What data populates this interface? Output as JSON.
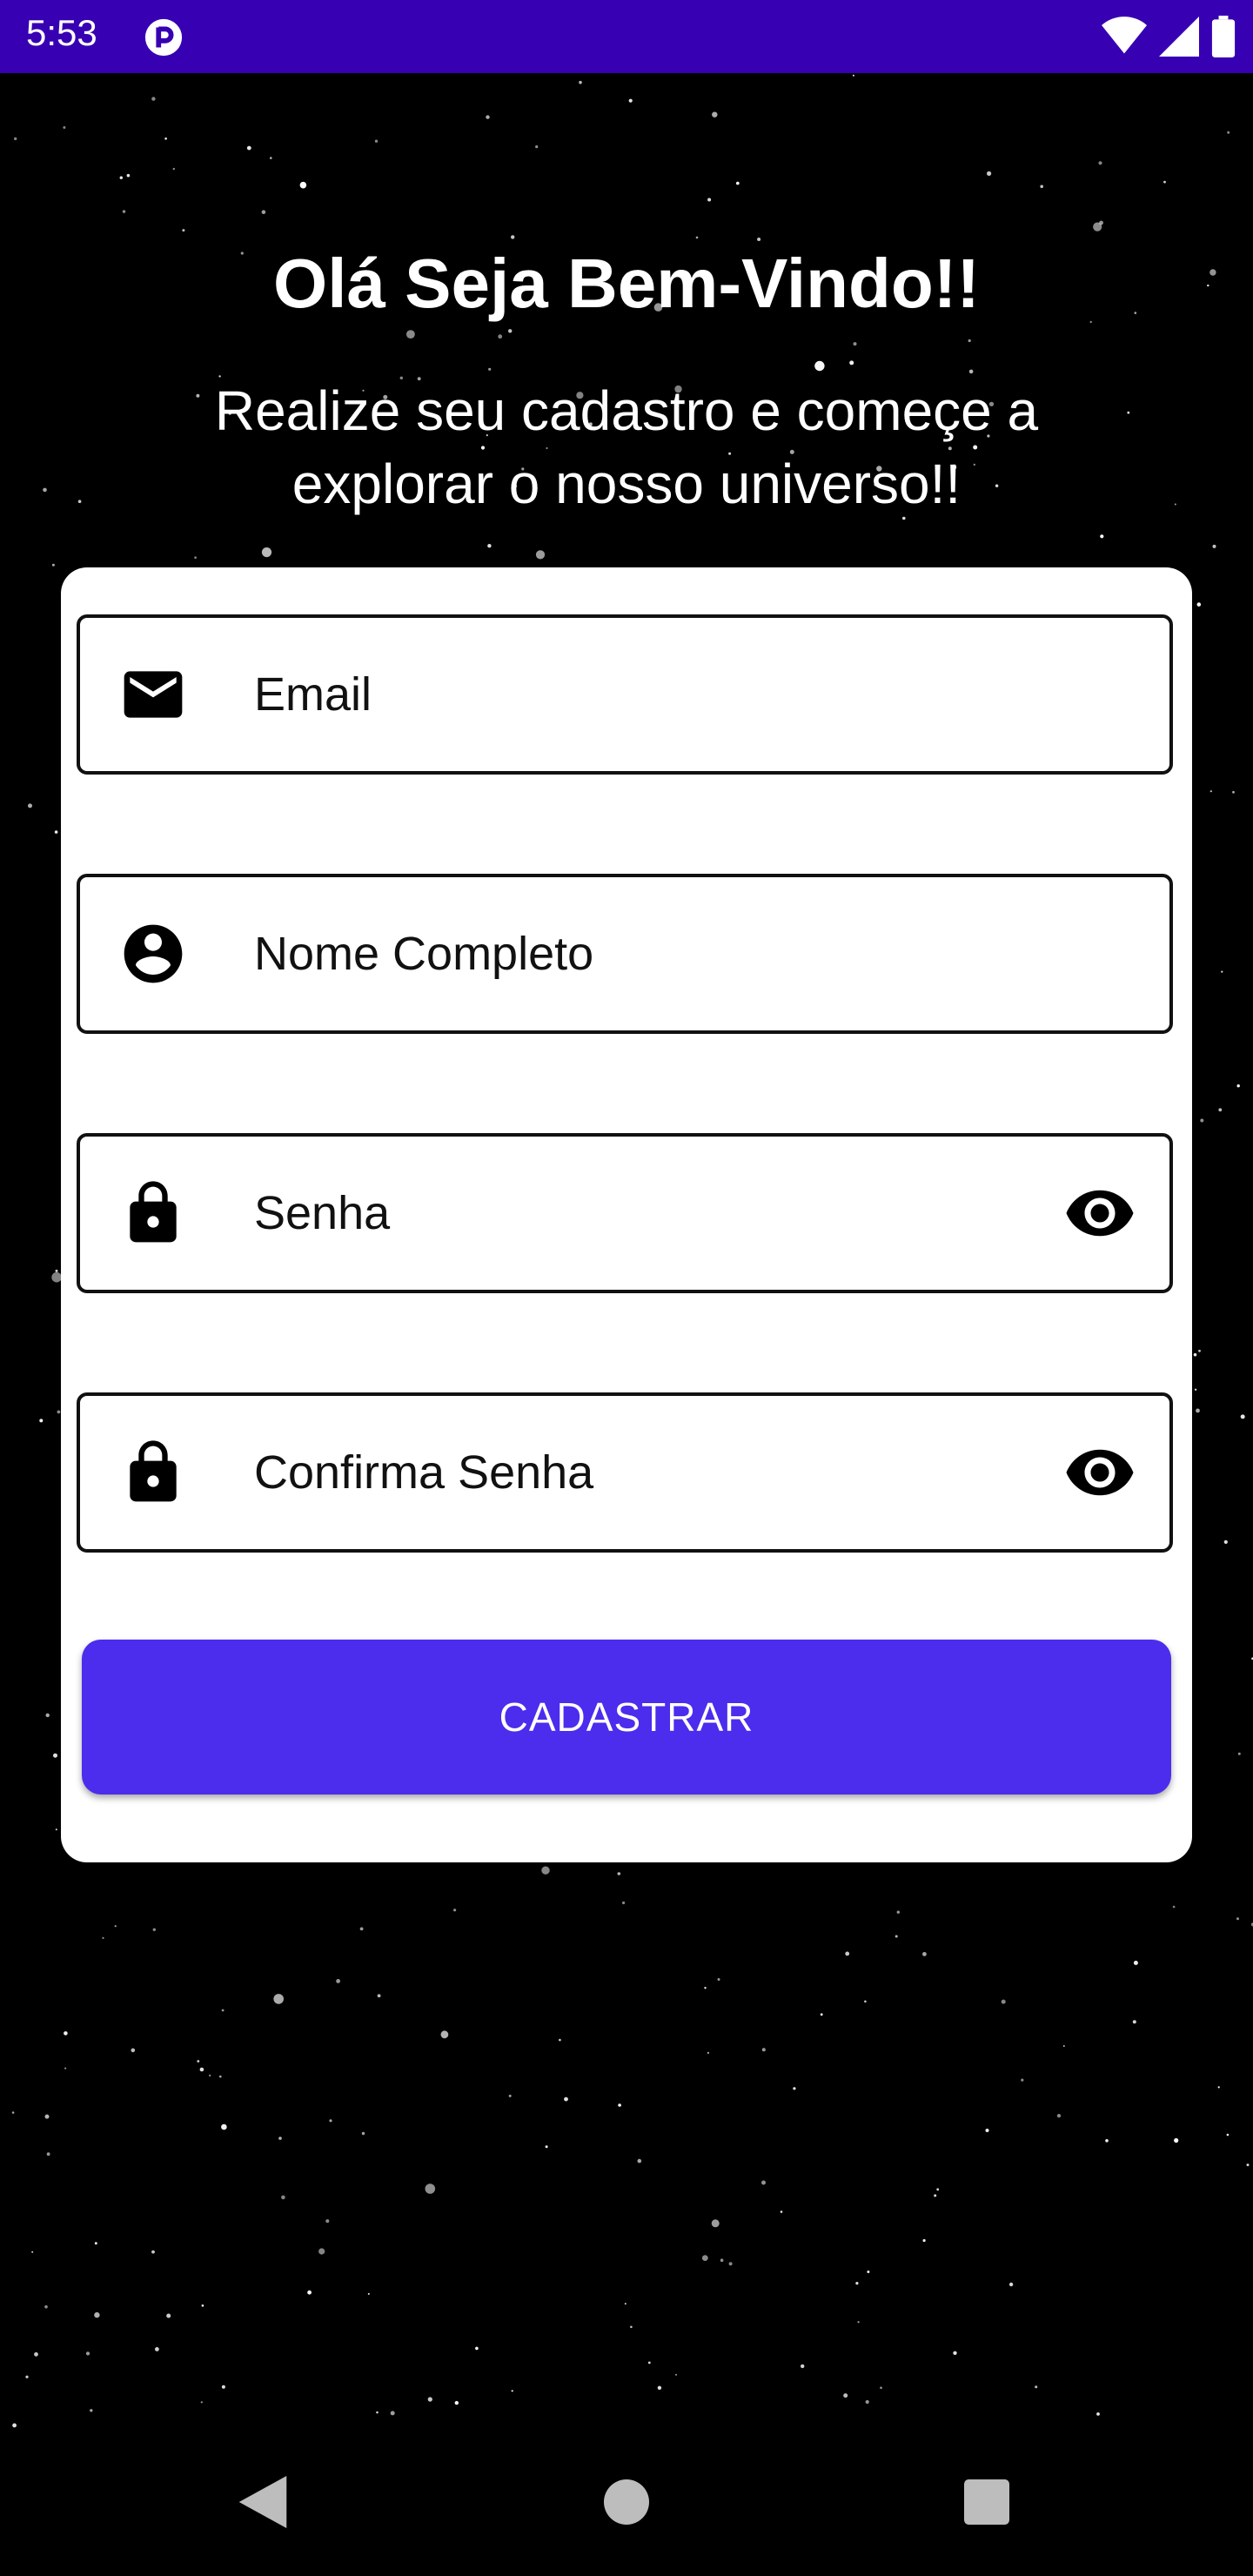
{
  "status_bar": {
    "time": "5:53",
    "app_icon": "app-notification-icon",
    "icons": [
      "wifi-icon",
      "cell-signal-icon",
      "battery-icon"
    ],
    "color": "#3700b3"
  },
  "header": {
    "title": "Olá Seja Bem-Vindo!!",
    "subtitle": "Realize seu cadastro e começe a explorar o nosso universo!!"
  },
  "form": {
    "fields": [
      {
        "placeholder": "Email",
        "icon": "email-icon"
      },
      {
        "placeholder": "Nome Completo",
        "icon": "account-circle-icon"
      },
      {
        "placeholder": "Senha",
        "icon": "lock-icon",
        "toggle_icon": "eye-icon"
      },
      {
        "placeholder": "Confirma Senha",
        "icon": "lock-icon",
        "toggle_icon": "eye-icon"
      }
    ],
    "submit_label": "CADASTRAR",
    "accent_color": "#4c2ced"
  },
  "nav_bar": {
    "buttons": [
      "back-icon",
      "home-icon",
      "recents-icon"
    ]
  }
}
